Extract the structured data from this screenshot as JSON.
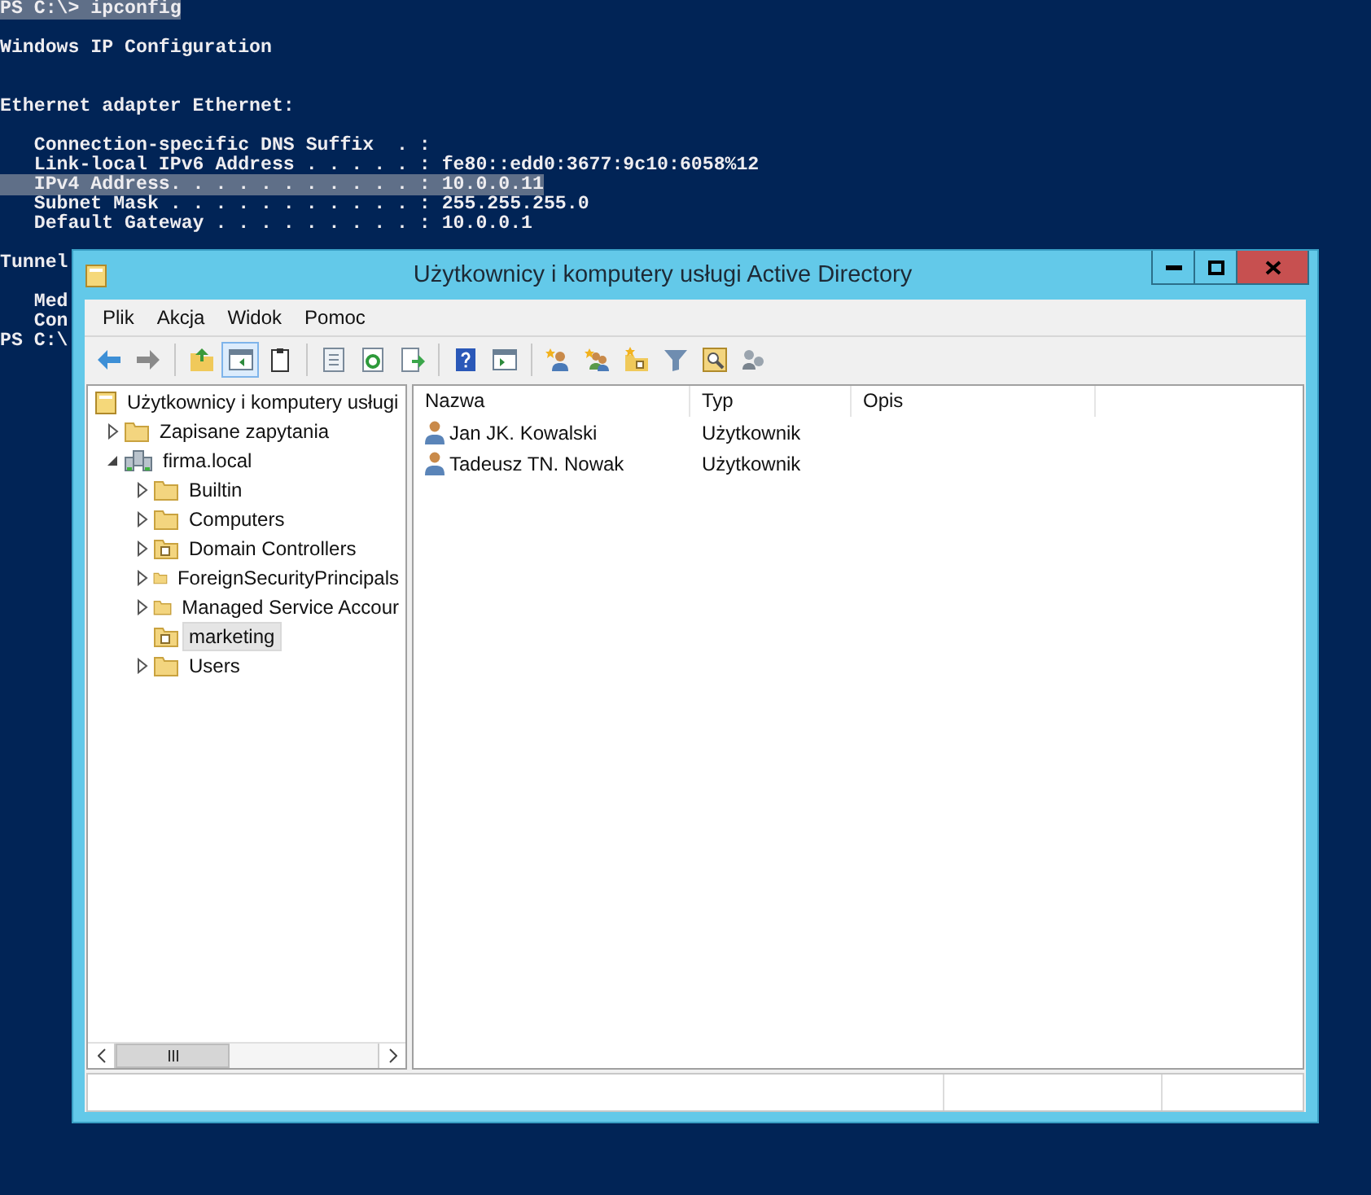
{
  "console": {
    "blocks": [
      {
        "kind": "command",
        "lines": [
          {
            "text": "PS C:\\> ipconfig",
            "highlighted": true
          }
        ]
      },
      {
        "kind": "heading",
        "lines": [
          {
            "text": "Windows IP Configuration",
            "highlighted": false
          }
        ]
      },
      {
        "kind": "section",
        "lines": [
          {
            "text": "Ethernet adapter Ethernet:",
            "highlighted": false
          }
        ]
      },
      {
        "kind": "details",
        "lines": [
          {
            "text": "   Connection-specific DNS Suffix  . :",
            "highlighted": false
          },
          {
            "text": "   Link-local IPv6 Address . . . . . : fe80::edd0:3677:9c10:6058%12",
            "highlighted": false
          },
          {
            "text": "   IPv4 Address. . . . . . . . . . . : 10.0.0.11",
            "highlighted": true
          },
          {
            "text": "   Subnet Mask . . . . . . . . . . . : 255.255.255.0",
            "highlighted": false
          },
          {
            "text": "   Default Gateway . . . . . . . . . : 10.0.0.1",
            "highlighted": false
          }
        ]
      },
      {
        "kind": "section",
        "lines": [
          {
            "text": "Tunnel",
            "highlighted": false
          }
        ]
      },
      {
        "kind": "details",
        "lines": [
          {
            "text": "   Med",
            "highlighted": false
          },
          {
            "text": "   Con",
            "highlighted": false
          },
          {
            "text": "PS C:\\",
            "highlighted": false
          }
        ]
      }
    ]
  },
  "window": {
    "title": "Użytkownicy i komputery usługi Active Directory",
    "menu": [
      "Plik",
      "Akcja",
      "Widok",
      "Pomoc"
    ],
    "toolbar": [
      [
        {
          "kind": "back",
          "selected": false
        },
        {
          "kind": "forward",
          "selected": false
        }
      ],
      [
        {
          "kind": "up",
          "selected": false
        },
        {
          "kind": "tree",
          "selected": true
        },
        {
          "kind": "clipboard",
          "selected": false
        }
      ],
      [
        {
          "kind": "properties",
          "selected": false
        },
        {
          "kind": "refresh",
          "selected": false
        },
        {
          "kind": "export",
          "selected": false
        }
      ],
      [
        {
          "kind": "help",
          "selected": false
        },
        {
          "kind": "pane",
          "selected": false
        }
      ],
      [
        {
          "kind": "new-user",
          "selected": false
        },
        {
          "kind": "new-group",
          "selected": false
        },
        {
          "kind": "new-ou",
          "selected": false
        },
        {
          "kind": "filter",
          "selected": false
        },
        {
          "kind": "find",
          "selected": false
        },
        {
          "kind": "delegate",
          "selected": false
        }
      ]
    ],
    "tree": [
      {
        "label": "Użytkownicy i komputery usługi",
        "kind": "root",
        "expandable": false,
        "selected": false,
        "children": [
          {
            "label": "Zapisane zapytania",
            "kind": "folder",
            "expandable": true,
            "expanded": false,
            "selected": false
          },
          {
            "label": "firma.local",
            "kind": "domain",
            "expandable": true,
            "expanded": true,
            "selected": false,
            "children": [
              {
                "label": "Builtin",
                "kind": "folder",
                "expandable": true,
                "expanded": false,
                "selected": false
              },
              {
                "label": "Computers",
                "kind": "folder",
                "expandable": true,
                "expanded": false,
                "selected": false
              },
              {
                "label": "Domain Controllers",
                "kind": "ou",
                "expandable": true,
                "expanded": false,
                "selected": false
              },
              {
                "label": "ForeignSecurityPrincipals",
                "kind": "folder",
                "expandable": true,
                "expanded": false,
                "selected": false
              },
              {
                "label": "Managed Service Accour",
                "kind": "folder",
                "expandable": true,
                "expanded": false,
                "selected": false
              },
              {
                "label": "marketing",
                "kind": "ou",
                "expandable": false,
                "selected": true
              },
              {
                "label": "Users",
                "kind": "folder",
                "expandable": true,
                "expanded": false,
                "selected": false
              }
            ]
          }
        ]
      }
    ],
    "list": {
      "columns": [
        "Nazwa",
        "Typ",
        "Opis"
      ],
      "rows": [
        {
          "name": "Jan JK. Kowalski",
          "type": "Użytkownik"
        },
        {
          "name": "Tadeusz TN. Nowak",
          "type": "Użytkownik"
        }
      ]
    }
  }
}
